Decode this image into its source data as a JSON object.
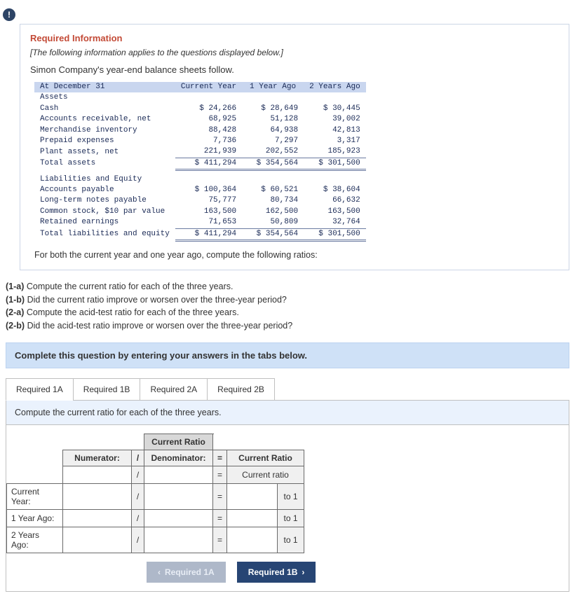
{
  "alert_glyph": "!",
  "required": {
    "title": "Required Information",
    "applies": "[The following information applies to the questions displayed below.]",
    "intro": "Simon Company's year-end balance sheets follow.",
    "headers": {
      "at": "At December 31",
      "cy": "Current Year",
      "y1": "1 Year Ago",
      "y2": "2 Years Ago"
    },
    "sections": {
      "assets_label": "Assets",
      "liab_label": "Liabilities and Equity",
      "total_assets": "Total assets",
      "total_le": "Total liabilities and equity"
    },
    "rows": {
      "cash": {
        "l": "Cash",
        "cy": "$ 24,266",
        "y1": "$ 28,649",
        "y2": "$ 30,445"
      },
      "ar": {
        "l": "Accounts receivable, net",
        "cy": "68,925",
        "y1": "51,128",
        "y2": "39,002"
      },
      "inv": {
        "l": "Merchandise inventory",
        "cy": "88,428",
        "y1": "64,938",
        "y2": "42,813"
      },
      "pre": {
        "l": "Prepaid expenses",
        "cy": "7,736",
        "y1": "7,297",
        "y2": "3,317"
      },
      "plant": {
        "l": "Plant assets, net",
        "cy": "221,939",
        "y1": "202,552",
        "y2": "185,923"
      },
      "ta": {
        "cy": "$ 411,294",
        "y1": "$ 354,564",
        "y2": "$ 301,500"
      },
      "ap": {
        "l": "Accounts payable",
        "cy": "$ 100,364",
        "y1": "$ 60,521",
        "y2": "$ 38,604"
      },
      "ltn": {
        "l": "Long-term notes payable",
        "cy": "75,777",
        "y1": "80,734",
        "y2": "66,632"
      },
      "cs": {
        "l": "Common stock, $10 par value",
        "cy": "163,500",
        "y1": "162,500",
        "y2": "163,500"
      },
      "re": {
        "l": "Retained earnings",
        "cy": "71,653",
        "y1": "50,809",
        "y2": "32,764"
      },
      "tle": {
        "cy": "$ 411,294",
        "y1": "$ 354,564",
        "y2": "$ 301,500"
      }
    },
    "instr": "For both the current year and one year ago, compute the following ratios:"
  },
  "questions": {
    "q1a": "(1-a) ",
    "q1a_t": "Compute the current ratio for each of the three years.",
    "q1b": "(1-b) ",
    "q1b_t": "Did the current ratio improve or worsen over the three-year period?",
    "q2a": "(2-a) ",
    "q2a_t": "Compute the acid-test ratio for each of the three years.",
    "q2b": "(2-b) ",
    "q2b_t": "Did the acid-test ratio improve or worsen over the three-year period?"
  },
  "complete_bar": "Complete this question by entering your answers in the tabs below.",
  "tabs": {
    "t1a": "Required 1A",
    "t1b": "Required 1B",
    "t2a": "Required 2A",
    "t2b": "Required 2B"
  },
  "panel": {
    "instr": "Compute the current ratio for each of the three years.",
    "header_cr": "Current Ratio",
    "numerator": "Numerator:",
    "slash": "/",
    "denominator": "Denominator:",
    "eq": "=",
    "cr2": "Current Ratio",
    "cr3": "Current ratio",
    "row_cy": "Current Year:",
    "row_y1": "1 Year Ago:",
    "row_y2": "2 Years Ago:",
    "to1": "to 1"
  },
  "nav": {
    "prev": "Required 1A",
    "next": "Required 1B",
    "lchev": "‹",
    "rchev": "›"
  }
}
